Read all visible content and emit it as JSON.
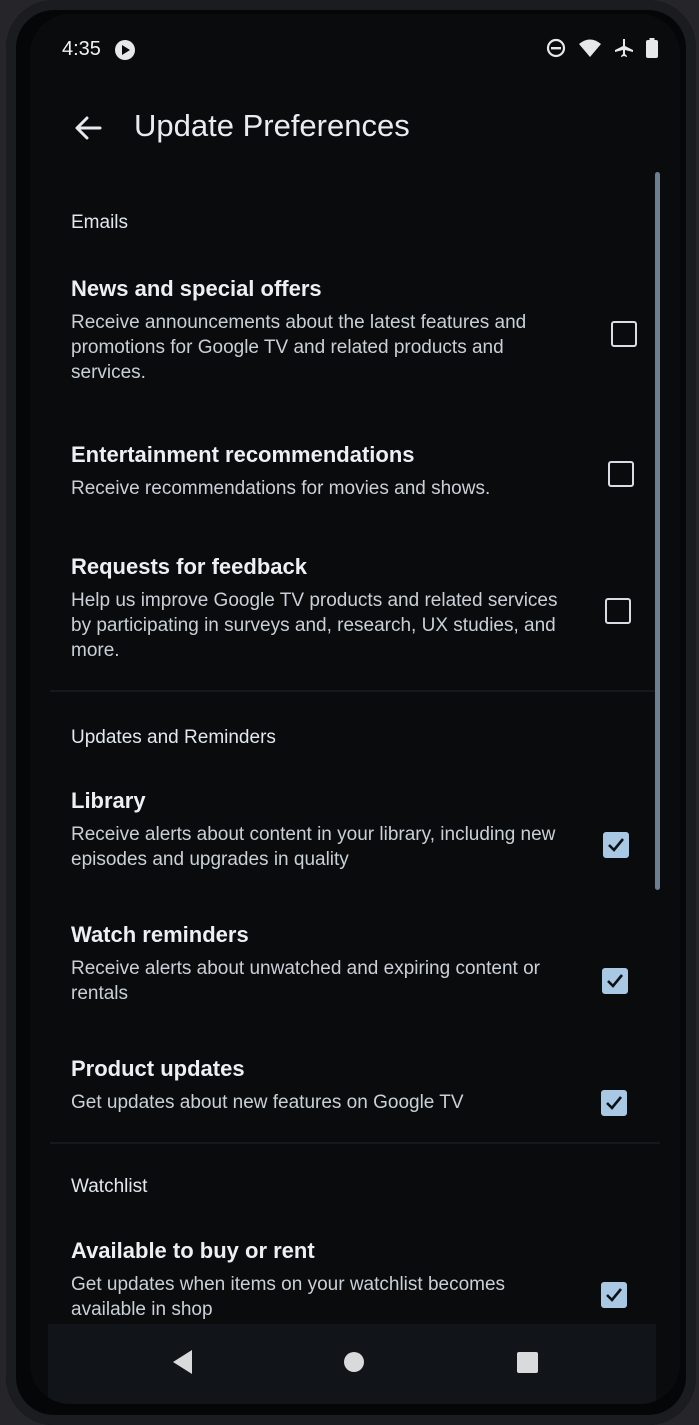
{
  "status_bar": {
    "time": "4:35",
    "icons": [
      "media-app-icon",
      "do-not-disturb-icon",
      "wifi-icon",
      "airplane-icon",
      "battery-icon"
    ]
  },
  "header": {
    "title": "Update Preferences",
    "back_icon": "arrow-left-icon"
  },
  "sections": {
    "emails": {
      "header": "Emails",
      "items": [
        {
          "title": "News and special offers",
          "description": "Receive announcements about the latest features and promotions for Google TV and related products and services.",
          "checked": false
        },
        {
          "title": "Entertainment recommendations",
          "description": "Receive recommendations for movies and shows.",
          "checked": false
        },
        {
          "title": "Requests for feedback",
          "description": "Help us improve Google TV products and related services by participating in surveys and, research, UX studies, and more.",
          "checked": false
        }
      ]
    },
    "updates": {
      "header": "Updates and Reminders",
      "items": [
        {
          "title": "Library",
          "description": "Receive alerts about content in your library, including new episodes and upgrades in quality",
          "checked": true
        },
        {
          "title": "Watch reminders",
          "description": "Receive alerts about unwatched and expiring content or rentals",
          "checked": true
        },
        {
          "title": "Product updates",
          "description": "Get updates about new features on Google TV",
          "checked": true
        }
      ]
    },
    "watchlist": {
      "header": "Watchlist",
      "items": [
        {
          "title": "Available to buy or rent",
          "description": "Get updates when items on your watchlist becomes available in shop",
          "checked": true
        }
      ]
    }
  },
  "nav_bar": {
    "icons": [
      "back-triangle-icon",
      "home-circle-icon",
      "recents-square-icon"
    ]
  },
  "colors": {
    "background": "#090b0d",
    "checkbox_checked": "#a9c8e3",
    "text_primary": "#edf0f3"
  }
}
